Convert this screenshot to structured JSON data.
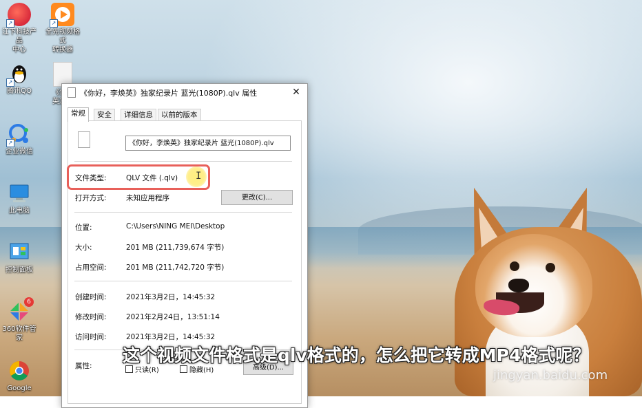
{
  "desktop": {
    "icons": [
      {
        "label": "江下科技产品中心",
        "lines": [
          "江下科技产品",
          "中心"
        ]
      },
      {
        "label": "全先视频格式转换器",
        "lines": [
          "全先视频格式",
          "转换器"
        ]
      },
      {
        "label": "腾讯QQ",
        "lines": [
          "腾讯QQ"
        ]
      },
      {
        "label": "《你好，李焕英》独家纪录片",
        "lines": [
          "《你好",
          "英》独"
        ]
      },
      {
        "label": "企业微信",
        "lines": [
          "企业微信"
        ]
      },
      {
        "label": "此电脑",
        "lines": [
          "此电脑"
        ]
      },
      {
        "label": "控制面板",
        "lines": [
          "控制面板"
        ]
      },
      {
        "label": "360软件管家",
        "lines": [
          "360软件管家"
        ],
        "badge": "6"
      },
      {
        "label": "Google",
        "lines": [
          "Google"
        ]
      }
    ]
  },
  "dialog": {
    "title": "《你好，李焕英》独家纪录片 蓝光(1080P).qlv 属性",
    "close_label": "✕",
    "tabs": [
      "常规",
      "安全",
      "详细信息",
      "以前的版本"
    ],
    "filename": "《你好，李焕英》独家纪录片 蓝光(1080P).qlv",
    "file_type_label": "文件类型:",
    "file_type_value": "QLV 文件 (.qlv)",
    "open_with_label": "打开方式:",
    "open_with_value": "未知应用程序",
    "change_button": "更改(C)...",
    "location_label": "位置:",
    "location_value": "C:\\Users\\NING MEI\\Desktop",
    "size_label": "大小:",
    "size_value": "201 MB (211,739,674 字节)",
    "size_on_disk_label": "占用空间:",
    "size_on_disk_value": "201 MB (211,742,720 字节)",
    "created_label": "创建时间:",
    "created_value": "2021年3月2日，14:45:32",
    "modified_label": "修改时间:",
    "modified_value": "2021年2月24日，13:51:14",
    "accessed_label": "访问时间:",
    "accessed_value": "2021年3月2日，14:45:32",
    "attributes_label": "属性:",
    "readonly_label": "只读(R)",
    "hidden_label": "隐藏(H)",
    "advanced_button": "高级(D)..."
  },
  "caption": "这个视频文件格式是qlv格式的，怎么把它转成MP4格式呢？",
  "watermark": "jingyan.baidu.com",
  "colors": {
    "highlight_border": "#e8605a",
    "cursor_glow": "#ffe878"
  }
}
